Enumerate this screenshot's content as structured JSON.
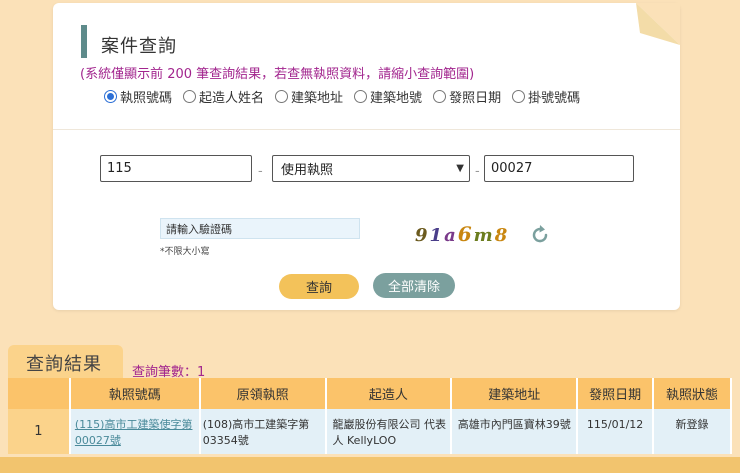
{
  "search": {
    "title": "案件查詢",
    "note": "(系統僅顯示前 200 筆查詢結果，若查無執照資料，請縮小查詢範圍)",
    "radios": [
      {
        "label": "執照號碼",
        "checked": true
      },
      {
        "label": "起造人姓名",
        "checked": false
      },
      {
        "label": "建築地址",
        "checked": false
      },
      {
        "label": "建築地號",
        "checked": false
      },
      {
        "label": "發照日期",
        "checked": false
      },
      {
        "label": "掛號號碼",
        "checked": false
      }
    ],
    "year_value": "115",
    "type_value": "使用執照",
    "number_value": "00027",
    "dash": "-",
    "captcha_placeholder": "請輸入驗證碼",
    "captcha_hint": "*不限大小寫",
    "captcha_chars": [
      "9",
      "1",
      "a",
      "6",
      "m",
      "8"
    ],
    "search_button": "查詢",
    "clear_button": "全部清除"
  },
  "results": {
    "tab_label": "查詢結果",
    "count_text": "查詢筆數：1",
    "headers": [
      "",
      "執照號碼",
      "原領執照",
      "起造人",
      "建築地址",
      "發照日期",
      "執照狀態"
    ],
    "rows": [
      {
        "index": "1",
        "license_no": "(115)高市工建築使字第00027號",
        "original_license": "(108)高市工建築字第03354號",
        "builder": "龍巖股份有限公司 代表人 KellyLOO",
        "address": "高雄市內門區寶林39號",
        "issue_date": "115/01/12",
        "status": "新登錄"
      }
    ]
  },
  "colors": {
    "accent_teal": "#5e8b8b",
    "note_magenta": "#a2258e",
    "header_orange": "#fbc36a",
    "background": "#fbe1b8"
  }
}
